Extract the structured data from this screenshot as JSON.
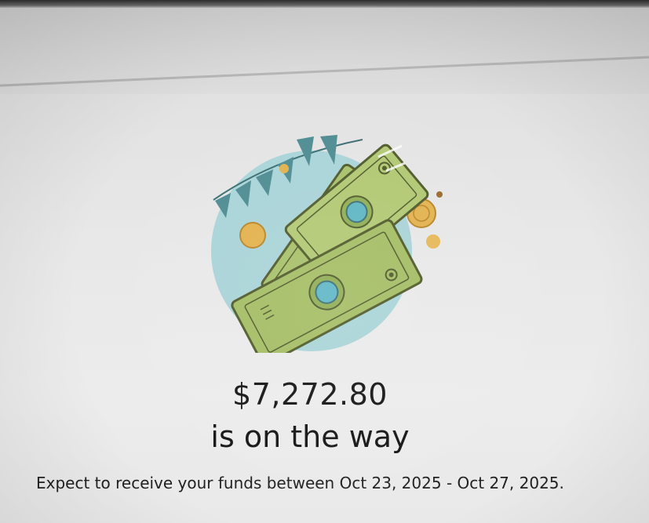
{
  "confirmation": {
    "amount": "$7,272.80",
    "status_text": "is on the way",
    "expect_message": "Expect to receive your funds between Oct 23, 2025 - Oct 27, 2025."
  },
  "illustration": {
    "icon": "money-celebration-icon",
    "colors": {
      "circle_bg": "#a9d4d8",
      "bill_green": "#a8c06a",
      "bill_dark": "#5e6b33",
      "seal_teal": "#5fb6c4",
      "coin_gold": "#e2b24e",
      "bunting_teal": "#4e8c92"
    }
  }
}
